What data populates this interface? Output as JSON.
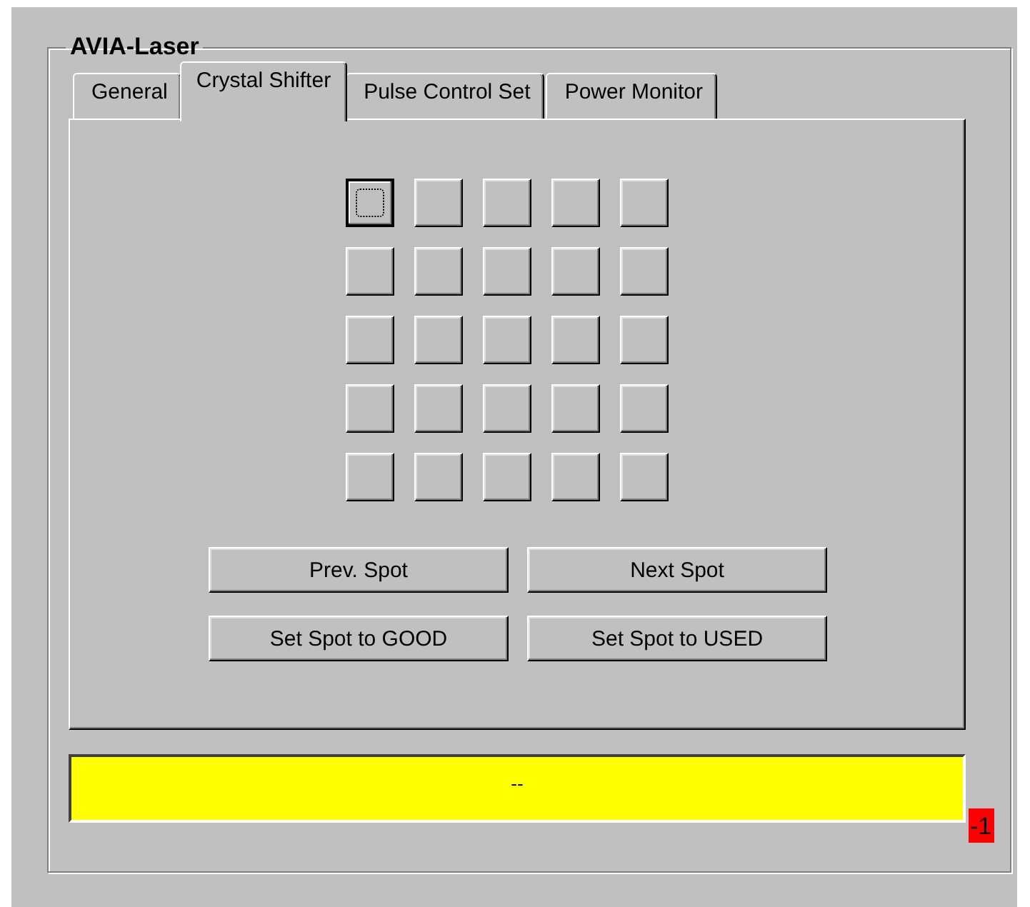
{
  "group": {
    "title": "AVIA-Laser"
  },
  "tabs": [
    {
      "label": "General",
      "selected": false
    },
    {
      "label": "Crystal Shifter",
      "selected": true
    },
    {
      "label": "Pulse Control Set",
      "selected": false
    },
    {
      "label": "Power Monitor",
      "selected": false
    }
  ],
  "spot_grid": [
    [
      {
        "focused": true
      },
      {
        "focused": false
      },
      {
        "focused": false
      },
      {
        "focused": false
      },
      {
        "focused": false
      }
    ],
    [
      {
        "focused": false
      },
      {
        "focused": false
      },
      {
        "focused": false
      },
      {
        "focused": false
      },
      {
        "focused": false
      }
    ],
    [
      {
        "focused": false
      },
      {
        "focused": false
      },
      {
        "focused": false
      },
      {
        "focused": false
      },
      {
        "focused": false
      }
    ],
    [
      {
        "focused": false
      },
      {
        "focused": false
      },
      {
        "focused": false
      },
      {
        "focused": false
      },
      {
        "focused": false
      }
    ],
    [
      {
        "focused": false
      },
      {
        "focused": false
      },
      {
        "focused": false
      },
      {
        "focused": false
      },
      {
        "focused": false
      }
    ]
  ],
  "buttons": [
    [
      "Prev. Spot",
      "Next Spot"
    ],
    [
      "Set Spot to GOOD",
      "Set Spot to USED"
    ]
  ],
  "status": {
    "text": "--",
    "color": "#ffff00"
  },
  "badge": {
    "text": "-1",
    "color": "#ff0000"
  }
}
